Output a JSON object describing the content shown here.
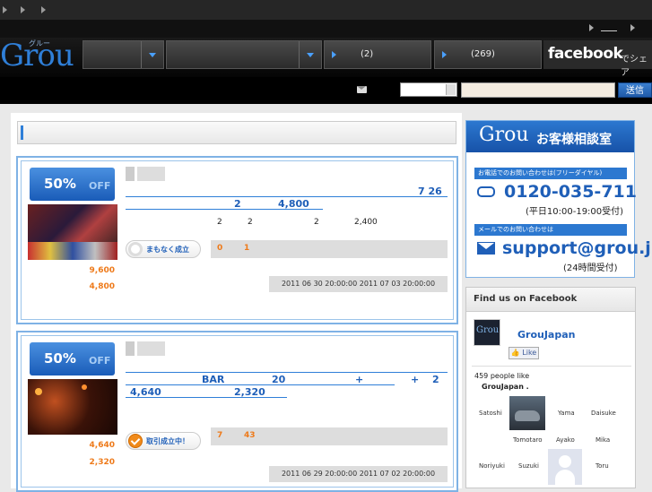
{
  "header": {
    "logo": "Grou",
    "logo_sub": "グルー",
    "nav": [
      {
        "label": "(2)"
      },
      {
        "label": "(269)"
      }
    ],
    "facebook_share": {
      "brand": "facebook",
      "suffix": "でシェア"
    },
    "top_links": [
      "",
      ""
    ],
    "submit_label": "送信"
  },
  "deals": [
    {
      "discount": "50%",
      "off": "OFF",
      "title_line1": "7  26",
      "title_line2_a": "2",
      "title_line2_b": "4,800",
      "detail_a": "2",
      "detail_b": "2",
      "detail_c": "2",
      "detail_d": "2,400",
      "original_price": "9,600",
      "price": "4,800",
      "status": "まもなく成立",
      "count_a": "0",
      "count_b": "1",
      "period": "2011 06 30 20:00:00 2011 07 03 20:00:00"
    },
    {
      "discount": "50%",
      "off": "OFF",
      "title_line1_a": "BAR",
      "title_line1_b": "20",
      "title_line1_c": "+",
      "title_line1_d": "+",
      "title_line1_e": "2",
      "title_line2_a": "4,640",
      "title_line2_b": "2,320",
      "original_price": "4,640",
      "price": "2,320",
      "status": "取引成立中！",
      "count_a": "7",
      "count_b": "43",
      "period": "2011 06 29 20:00:00 2011 07 02 20:00:00"
    }
  ],
  "support": {
    "logo": "Grou",
    "title": "お客様相談室",
    "phone_label": "お電話でのお問い合わせは(フリーダイヤル)",
    "phone": "0120-035-711",
    "phone_hours": "(平日10:00-19:00受付)",
    "mail_label": "メールでのお問い合わせは",
    "email": "support@grou.jp",
    "mail_hours": "(24時間受付)"
  },
  "facebook_box": {
    "title": "Find us on Facebook",
    "logo": "Grou",
    "page_name": "GrouJapan",
    "like_label": "Like",
    "count_text": "459 people like",
    "name_text": "GrouJapan .",
    "friends": [
      "Satoshi",
      "Yama",
      "Daisuke",
      "Tomotaro",
      "Ayako",
      "Mika",
      "Noriyuki",
      "Suzuki",
      "Toru"
    ]
  },
  "colors": {
    "accent": "#2f7fd8",
    "price": "#ee7a1a",
    "header_bg": "#111111"
  }
}
